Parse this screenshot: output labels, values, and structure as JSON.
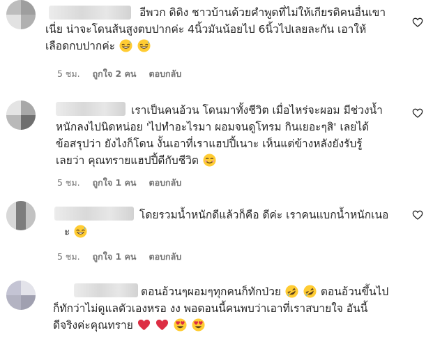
{
  "comments": [
    {
      "lines": [
        "อีพวก ดิดิง ชาวบ้านด้วยคำพูดที่ไม่ให้เกียรติคนอื่นเขา",
        "เนี่ย น่าจะโดนส้นสูงตบปากค่ะ 4นิ้วมันน้อยไป 6นิ้วไปเลยละกัน เอาให้",
        "เลือดกบปากค่ะ"
      ],
      "time": "5 ชม.",
      "likes": "ถูกใจ 2 คน",
      "reply": "ตอบกลับ",
      "emojis": [
        "grinning-sweat-emoji",
        "grinning-sweat-emoji"
      ]
    },
    {
      "lines": [
        "เราเป็นคนอ้วน โดนมาทั้งชีวิต เมื่อไหร่จะผอม มีช่วงน้ำ",
        "หนักลงไปนิดหน่อย 'ไปทำอะไรมา ผอมจนดูโทรม กินเยอะๆสิ' เลยได้",
        "ข้อสรุปว่า ยังไงก็โดน งั้นเอาที่เราแฮปปี้เนาะ เห็นแต่ข้างหลังยังรับรู้",
        "เลยว่า คุณทรายแฮปปี้ดีกับชีวิต"
      ],
      "time": "5 ชม.",
      "likes": "ถูกใจ 1 คน",
      "reply": "ตอบกลับ",
      "emojis": [
        "smiling-emoji"
      ]
    },
    {
      "lines": [
        "โดยรวมน้ำหนักดีแล้วก็คือ ดีค่ะ เราคนแบกน้ำหนักเนอ",
        "ะ"
      ],
      "time": "5 ชม.",
      "likes": "ถูกใจ 1 คน",
      "reply": "ตอบกลับ",
      "emojis": [
        "grinning-sweat-emoji"
      ]
    },
    {
      "lines": [
        "ตอนอ้วนๆผอมๆทุกคนก็ทักป่วย",
        "ตอนอ้วนขึ้นไป",
        "ก็ทักว่าไม่ดูแลตัวเองหรอ งง พอตอนนี้คนพบว่าเอาที่เราสบายใจ อันนี้",
        "ดีจริงค่ะคุณทราย"
      ],
      "time": "",
      "likes": "",
      "reply": "",
      "emojis": [
        "rofl-emoji",
        "rofl-emoji",
        "red-heart-emoji",
        "red-heart-emoji",
        "heart-eyes-emoji",
        "heart-eyes-emoji"
      ]
    }
  ]
}
